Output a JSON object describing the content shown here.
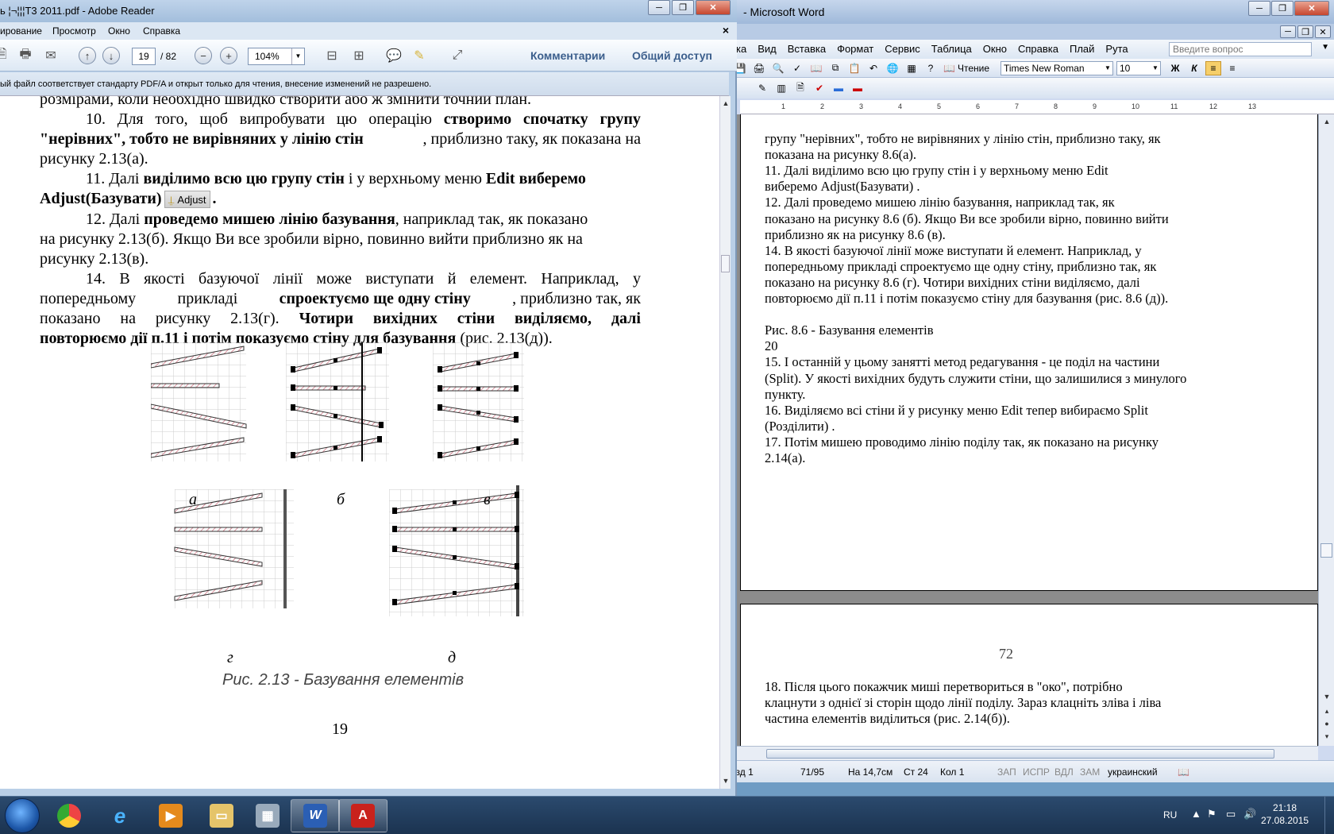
{
  "word": {
    "title": "- Microsoft Word",
    "menu": [
      "ка",
      "Вид",
      "Вставка",
      "Формат",
      "Сервис",
      "Таблица",
      "Окно",
      "Справка",
      "Плай",
      "Рута"
    ],
    "help_placeholder": "Введите вопрос",
    "reading_label": "Чтение",
    "font_name": "Times New Roman",
    "font_size": "10",
    "bold_btn": "Ж",
    "italic_btn": "К",
    "ruler_numbers": [
      "1",
      "2",
      "3",
      "4",
      "5",
      "6",
      "7",
      "8",
      "9",
      "10",
      "11",
      "12",
      "13"
    ],
    "page1_lines": [
      "групу \"нерівних\", тобто не вирівняних у лінію стін, приблизно таку, як",
      "показана на рисунку 8.6(а).",
      "            11. Далі виділимо всю цю групу стін і у верхньому меню Edit",
      "виберемо Adjust(Базувати) .",
      "            12. Далі проведемо мишею лінію базування, наприклад так, як",
      "показано на рисунку 8.6 (б). Якщо Ви все зробили вірно, повинно вийти",
      "приблизно як на рисунку 8.6 (в).",
      "            14. В якості базуючої лінії може виступати й елемент. Наприклад, у",
      "попередньому прикладі спроектуємо ще одну стіну, приблизно так, як",
      "показано на рисунку 8.6 (г). Чотири вихідних стіни виділяємо, далі",
      "повторюємо дії п.11 і потім показуємо стіну для базування (рис. 8.6 (д)).",
      "",
      "Рис. 8.6 - Базування елементів",
      "20",
      "15. І останній у цьому занятті метод редагування - це поділ на частини",
      "(Split). У якості вихідних будуть служити стіни, що залишилися з минулого",
      "пункту.",
      "16. Виділяємо всі стіни й у рисунку меню Edit тепер вибираємо Split",
      "(Розділити) .",
      "17. Потім мишею проводимо лінію поділу так, як показано на рисунку",
      "2.14(а)."
    ],
    "page2_number": "72",
    "page2_lines": [
      "18. Після цього покажчик миші перетвориться в \"око\", потрібно",
      "клацнути з однієї зі сторін щодо лінії поділу. Зараз клацніть зліва і ліва",
      "частина елементів виділиться (рис. 2.14(б))."
    ],
    "status": {
      "section": "азд 1",
      "pages": "71/95",
      "position": "На 14,7см",
      "line": "Ст 24",
      "col": "Кол 1",
      "rec": "ЗАП",
      "trk": "ИСПР",
      "ext": "ВДЛ",
      "ovr": "ЗАМ",
      "language": "украинский"
    }
  },
  "adobe": {
    "title": "ь ¦¬¦¦¦Т3 2011.pdf - Adobe Reader",
    "menu": [
      "ирование",
      "Просмотр",
      "Окно",
      "Справка"
    ],
    "current_page": "19",
    "total_pages": "/ 82",
    "zoom": "104%",
    "comments_link": "Комментарии",
    "share_link": "Общий доступ",
    "notice": "ый файл соответствует стандарту PDF/A и открыт только для чтения, внесение изменений не разрешено.",
    "adjust_btn": "Adjust",
    "fig_labels": [
      "а",
      "б",
      "в",
      "г",
      "д"
    ],
    "caption": "Рис. 2.13 - Базування елементів",
    "page_number": "19"
  },
  "taskbar": {
    "lang": "RU",
    "time": "21:18",
    "date": "27.08.2015"
  },
  "colors": {
    "word_chrome": "#cfdaf0",
    "adobe_chrome": "#b9cfe7",
    "link_blue": "#3b5e8c",
    "taskbar": "#1b3350"
  }
}
